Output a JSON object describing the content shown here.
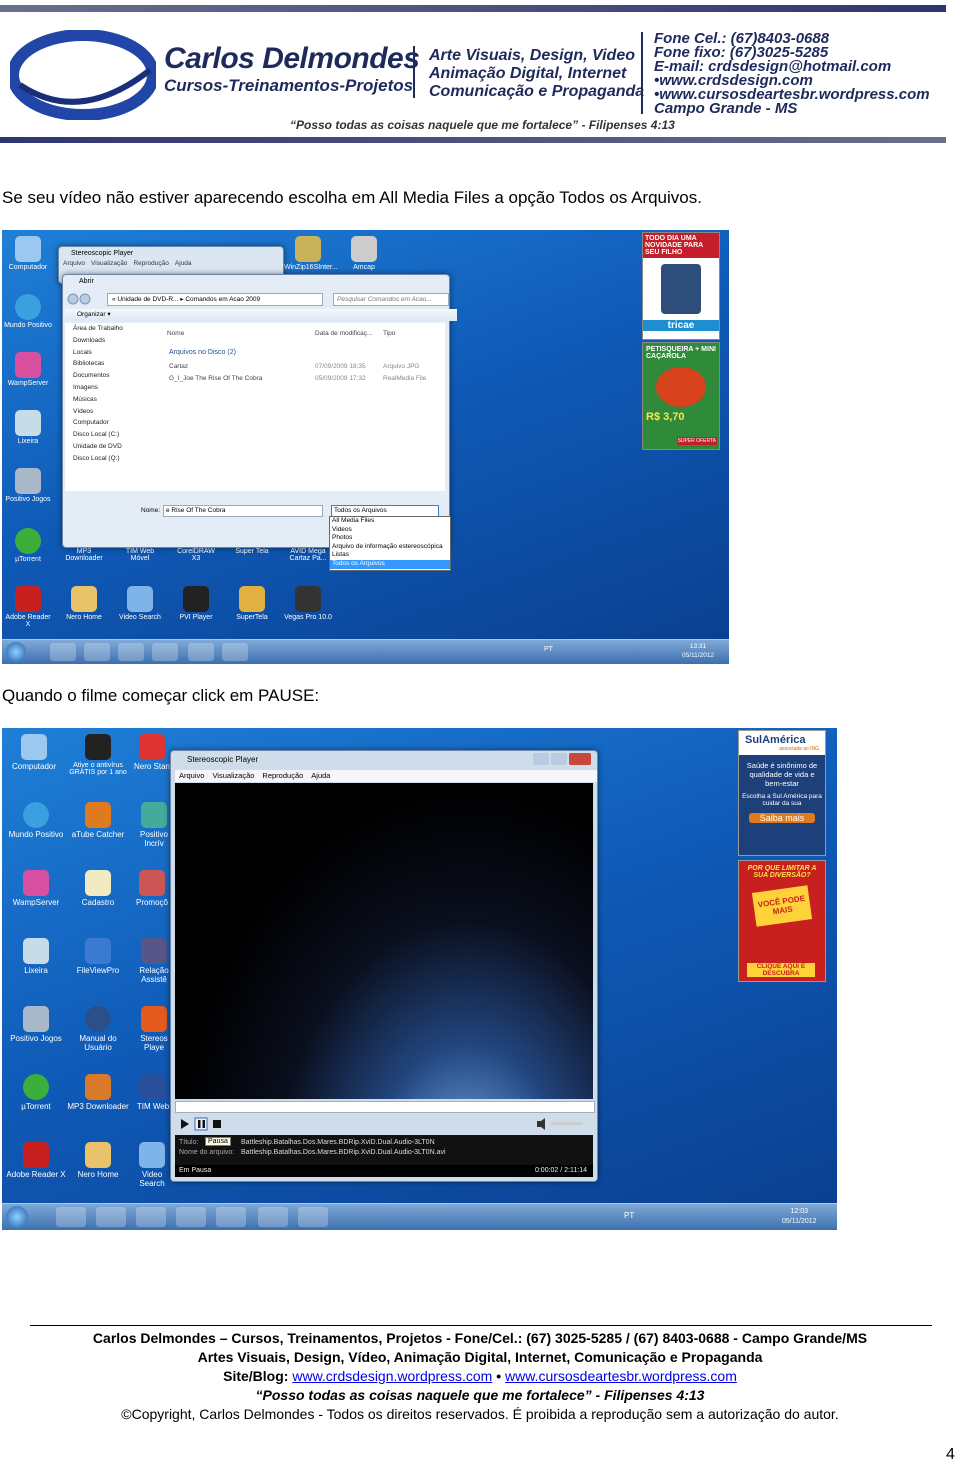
{
  "header": {
    "brand_name": "Carlos Delmondes",
    "brand_sub": "Cursos-Treinamentos-Projetos",
    "services": [
      "Arte Visuais, Design, Video",
      "Animação Digital, Internet",
      "Comunicação e Propaganda"
    ],
    "contacts": [
      "Fone Cel.: (67)8403-0688",
      "Fone fixo: (67)3025-5285",
      "E-mail: crdsdesign@hotmail.com",
      "•www.crdsdesign.com",
      "•www.cursosdeartesbr.wordpress.com",
      "Campo Grande - MS"
    ],
    "quote": "“Posso todas as coisas naquele que me fortalece” - Filipenses 4:13"
  },
  "body": {
    "paragraph1": "Se seu vídeo não estiver aparecendo escolha em All Media Files a opção Todos os Arquivos.",
    "paragraph2": "Quando o filme começar click em PAUSE:"
  },
  "screenshot1": {
    "window_title": "Stereoscopic Player",
    "menu": [
      "Arquivo",
      "Visualização",
      "Reprodução",
      "Ajuda"
    ],
    "dialog_title": "Abrir",
    "breadcrumb": "« Unidade de DVD-R... ▸ Comandos em Acao 2009",
    "search_placeholder": "Pesquisar Comandos em Acao...",
    "organize_label": "Organizar ▾",
    "nav_items": [
      "Área de Trabalho",
      "Downloads",
      "Locais",
      "Bibliotecas",
      "Documentos",
      "Imagens",
      "Músicas",
      "Vídeos",
      "Computador",
      "Disco Local (C:)",
      "Unidade de DVD",
      "Disco Local (Q:)"
    ],
    "columns": [
      "Nome",
      "Data de modificaç...",
      "Tipo"
    ],
    "group_label": "Arquivos no Disco (2)",
    "files": [
      {
        "name": "Cartaz",
        "date": "07/09/2009 18:35",
        "type": "Arquivo JPG"
      },
      {
        "name": "G_I_Joe The Rise Of The Cobra",
        "date": "05/09/2009 17:32",
        "type": "RealMedia File"
      }
    ],
    "filename_label": "Nome:",
    "filename_value": "e Rise Of The Cobra",
    "filetype_value": "Todos os Arquivos",
    "filetype_options": [
      "All Media Files",
      "Videos",
      "Photos",
      "Arquivo de informação estereoscópica",
      "Listas",
      "Todos os Arquivos"
    ],
    "desktop_icons": [
      "Computador",
      "Mundo Positivo",
      "WampServer",
      "Lixeira",
      "Positivo Jogos",
      "µTorrent",
      "MP3 Downloader",
      "TIM Web Móvel",
      "CorelDRAW X3",
      "Super Tela",
      "AVID Mega Cartaz Pa...",
      "Adobe Reader X",
      "Nero Home",
      "Video Search",
      "PVI Player",
      "SuperTela",
      "Vegas Pro 10.0",
      "WinZip16SInter...",
      "Amcap"
    ],
    "ad1_text": "TODO DIA UMA NOVIDADE PARA SEU FILHO",
    "ad1_brand": "tricae",
    "ad2_text": "PETISQUEIRA + MINI CAÇAROLA",
    "ad2_price": "R$ 3,70",
    "ad2_tag": "SUPER OFERTA",
    "lang": "PT",
    "time": "13:31",
    "date": "05/11/2012"
  },
  "screenshot2": {
    "window_title": "Stereoscopic Player",
    "menu": [
      "Arquivo",
      "Visualização",
      "Reprodução",
      "Ajuda"
    ],
    "title_label": "Título:",
    "name_label": "Nome do arquivo:",
    "pause_tooltip": "Pausa",
    "title_value": "Battleship.Batalhas.Dos.Mares.BDRip.XviD.Dual.Audio-3LT0N",
    "file_value": "Battleship.Batalhas.Dos.Mares.BDRip.XviD.Dual.Audio-3LT0N.avi",
    "status": "Em Pausa",
    "timecode": "0:00:02 / 2:11:14",
    "desktop_icons": [
      "Computador",
      "Ative o antivírus GRÁTIS por 1 ano",
      "Nero Stan",
      "Mundo Positivo",
      "aTube Catcher",
      "Positivo Incrív",
      "WampServer",
      "Cadastro",
      "Promoçõ",
      "Lixeira",
      "FileViewPro",
      "Relação Assistê",
      "Positivo Jogos",
      "Manual do Usuário",
      "Stereos Playe",
      "µTorrent",
      "MP3 Downloader",
      "TIM Web",
      "Adobe Reader X",
      "Nero Home",
      "Video Search"
    ],
    "ad1_brand": "SulAmérica",
    "ad1_sub": "associada ao ING",
    "ad1_text": "Saúde é sinônimo de qualidade de vida e bem-estar",
    "ad1_text2": "Escolha a Sul América para cuidar da sua",
    "ad1_button": "Saiba mais",
    "ad2_text": "POR QUE LIMITAR A SUA DIVERSÃO?",
    "ad2_mid": "VOCÊ PODE MAIS",
    "ad2_cta": "CLIQUE AQUI E DESCUBRA",
    "lang": "PT",
    "time": "12:03",
    "date": "05/11/2012"
  },
  "footer": {
    "line1": "Carlos Delmondes – Cursos, Treinamentos, Projetos - Fone/Cel.: (67) 3025-5285 / (67) 8403-0688  - Campo Grande/MS",
    "line2": "Artes Visuais, Design, Vídeo, Animação Digital, Internet, Comunicação e Propaganda",
    "site_label": "Site/Blog:",
    "link1": "www.crdsdesign.wordpress.com",
    "bullet": "•",
    "link2": "www.cursosdeartesbr.wordpress.com",
    "quote": "“Posso todas as coisas naquele que me fortalece” - Filipenses 4:13",
    "copyright": "©Copyright, Carlos Delmondes - Todos os direitos reservados. É proibida a reprodução sem a autorização do autor."
  },
  "page_number": "4",
  "colors": {
    "brand": "#1f2a5c",
    "link": "#0000ee",
    "desktop_blue": "#1566c4"
  }
}
